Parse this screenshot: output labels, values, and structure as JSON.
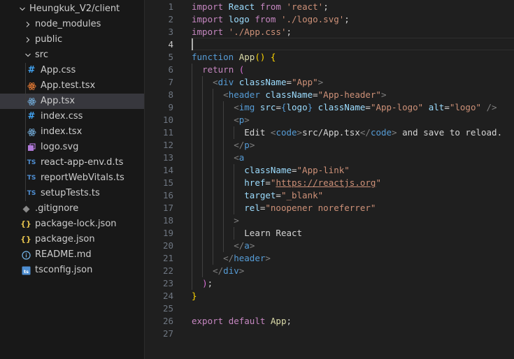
{
  "explorer": {
    "root_label": "Heungkuk_V2/client",
    "items": [
      {
        "label": "node_modules",
        "kind": "folder",
        "icon": "chevron-right-icon"
      },
      {
        "label": "public",
        "kind": "folder",
        "icon": "chevron-right-icon"
      },
      {
        "label": "src",
        "kind": "folder-open",
        "icon": "chevron-down-icon"
      },
      {
        "label": "App.css",
        "kind": "file",
        "icon": "css-file-icon",
        "icon_glyph": "#"
      },
      {
        "label": "App.test.tsx",
        "kind": "file",
        "icon": "react-test-file-icon",
        "icon_glyph": "⚙"
      },
      {
        "label": "App.tsx",
        "kind": "file",
        "icon": "react-file-icon",
        "icon_glyph": "⚛",
        "selected": true
      },
      {
        "label": "index.css",
        "kind": "file",
        "icon": "css-file-icon",
        "icon_glyph": "#"
      },
      {
        "label": "index.tsx",
        "kind": "file",
        "icon": "react-file-icon",
        "icon_glyph": "⚛"
      },
      {
        "label": "logo.svg",
        "kind": "file",
        "icon": "svg-file-icon",
        "icon_glyph": "◩"
      },
      {
        "label": "react-app-env.d.ts",
        "kind": "file",
        "icon": "typescript-file-icon",
        "icon_glyph": "TS"
      },
      {
        "label": "reportWebVitals.ts",
        "kind": "file",
        "icon": "typescript-file-icon",
        "icon_glyph": "TS"
      },
      {
        "label": "setupTests.ts",
        "kind": "file",
        "icon": "typescript-file-icon",
        "icon_glyph": "TS"
      },
      {
        "label": ".gitignore",
        "kind": "file",
        "icon": "gitignore-file-icon",
        "icon_glyph": "◆"
      },
      {
        "label": "package-lock.json",
        "kind": "file",
        "icon": "json-file-icon",
        "icon_glyph": "{}"
      },
      {
        "label": "package.json",
        "kind": "file",
        "icon": "json-file-icon",
        "icon_glyph": "{}"
      },
      {
        "label": "README.md",
        "kind": "file",
        "icon": "info-file-icon",
        "icon_glyph": "ⓘ"
      },
      {
        "label": "tsconfig.json",
        "kind": "file",
        "icon": "tsconfig-file-icon",
        "icon_glyph": "ts"
      }
    ]
  },
  "editor": {
    "active_line": 4,
    "lines": [
      [
        [
          "import",
          "ctl"
        ],
        [
          " ",
          "t"
        ],
        [
          "React",
          "v"
        ],
        [
          " ",
          "t"
        ],
        [
          "from",
          "ctl"
        ],
        [
          " ",
          "t"
        ],
        [
          "'react'",
          "s"
        ],
        [
          ";",
          "t"
        ]
      ],
      [
        [
          "import",
          "ctl"
        ],
        [
          " ",
          "t"
        ],
        [
          "logo",
          "v"
        ],
        [
          " ",
          "t"
        ],
        [
          "from",
          "ctl"
        ],
        [
          " ",
          "t"
        ],
        [
          "'./logo.svg'",
          "s"
        ],
        [
          ";",
          "t"
        ]
      ],
      [
        [
          "import",
          "ctl"
        ],
        [
          " ",
          "t"
        ],
        [
          "'./App.css'",
          "s"
        ],
        [
          ";",
          "t"
        ]
      ],
      [],
      [
        [
          "function",
          "k"
        ],
        [
          " ",
          "t"
        ],
        [
          "App",
          "fn"
        ],
        [
          "()",
          "y"
        ],
        [
          " ",
          "t"
        ],
        [
          "{",
          "y"
        ]
      ],
      [
        [
          "  ",
          "t"
        ],
        [
          "return",
          "ctl"
        ],
        [
          " ",
          "t"
        ],
        [
          "(",
          "pk"
        ]
      ],
      [
        [
          "    ",
          "t"
        ],
        [
          "<",
          "p"
        ],
        [
          "div",
          "tg"
        ],
        [
          " ",
          "t"
        ],
        [
          "className",
          "v"
        ],
        [
          "=",
          "t"
        ],
        [
          "\"App\"",
          "s"
        ],
        [
          ">",
          "p"
        ]
      ],
      [
        [
          "      ",
          "t"
        ],
        [
          "<",
          "p"
        ],
        [
          "header",
          "tg"
        ],
        [
          " ",
          "t"
        ],
        [
          "className",
          "v"
        ],
        [
          "=",
          "t"
        ],
        [
          "\"App-header\"",
          "s"
        ],
        [
          ">",
          "p"
        ]
      ],
      [
        [
          "        ",
          "t"
        ],
        [
          "<",
          "p"
        ],
        [
          "img",
          "tg"
        ],
        [
          " ",
          "t"
        ],
        [
          "src",
          "v"
        ],
        [
          "=",
          "t"
        ],
        [
          "{",
          "k"
        ],
        [
          "logo",
          "v"
        ],
        [
          "}",
          "k"
        ],
        [
          " ",
          "t"
        ],
        [
          "className",
          "v"
        ],
        [
          "=",
          "t"
        ],
        [
          "\"App-logo\"",
          "s"
        ],
        [
          " ",
          "t"
        ],
        [
          "alt",
          "v"
        ],
        [
          "=",
          "t"
        ],
        [
          "\"logo\"",
          "s"
        ],
        [
          " ",
          "t"
        ],
        [
          "/>",
          "p"
        ]
      ],
      [
        [
          "        ",
          "t"
        ],
        [
          "<",
          "p"
        ],
        [
          "p",
          "tg"
        ],
        [
          ">",
          "p"
        ]
      ],
      [
        [
          "          ",
          "t"
        ],
        [
          "Edit ",
          "t"
        ],
        [
          "<",
          "p"
        ],
        [
          "code",
          "tg"
        ],
        [
          ">",
          "p"
        ],
        [
          "src/App.tsx",
          "t"
        ],
        [
          "</",
          "p"
        ],
        [
          "code",
          "tg"
        ],
        [
          ">",
          "p"
        ],
        [
          " and save to reload.",
          "t"
        ]
      ],
      [
        [
          "        ",
          "t"
        ],
        [
          "</",
          "p"
        ],
        [
          "p",
          "tg"
        ],
        [
          ">",
          "p"
        ]
      ],
      [
        [
          "        ",
          "t"
        ],
        [
          "<",
          "p"
        ],
        [
          "a",
          "tg"
        ]
      ],
      [
        [
          "          ",
          "t"
        ],
        [
          "className",
          "v"
        ],
        [
          "=",
          "t"
        ],
        [
          "\"App-link\"",
          "s"
        ]
      ],
      [
        [
          "          ",
          "t"
        ],
        [
          "href",
          "v"
        ],
        [
          "=",
          "t"
        ],
        [
          "\"",
          "s"
        ],
        [
          "https://reactjs.org",
          "u"
        ],
        [
          "\"",
          "s"
        ]
      ],
      [
        [
          "          ",
          "t"
        ],
        [
          "target",
          "v"
        ],
        [
          "=",
          "t"
        ],
        [
          "\"_blank\"",
          "s"
        ]
      ],
      [
        [
          "          ",
          "t"
        ],
        [
          "rel",
          "v"
        ],
        [
          "=",
          "t"
        ],
        [
          "\"noopener noreferrer\"",
          "s"
        ]
      ],
      [
        [
          "        ",
          "t"
        ],
        [
          ">",
          "p"
        ]
      ],
      [
        [
          "          ",
          "t"
        ],
        [
          "Learn React",
          "t"
        ]
      ],
      [
        [
          "        ",
          "t"
        ],
        [
          "</",
          "p"
        ],
        [
          "a",
          "tg"
        ],
        [
          ">",
          "p"
        ]
      ],
      [
        [
          "      ",
          "t"
        ],
        [
          "</",
          "p"
        ],
        [
          "header",
          "tg"
        ],
        [
          ">",
          "p"
        ]
      ],
      [
        [
          "    ",
          "t"
        ],
        [
          "</",
          "p"
        ],
        [
          "div",
          "tg"
        ],
        [
          ">",
          "p"
        ]
      ],
      [
        [
          "  ",
          "t"
        ],
        [
          ")",
          "pk"
        ],
        [
          ";",
          "t"
        ]
      ],
      [
        [
          "}",
          "y"
        ]
      ],
      [],
      [
        [
          "export",
          "ctl"
        ],
        [
          " ",
          "t"
        ],
        [
          "default",
          "ctl"
        ],
        [
          " ",
          "t"
        ],
        [
          "App",
          "fn"
        ],
        [
          ";",
          "t"
        ]
      ],
      []
    ]
  },
  "colors": {
    "sidebar_bg": "#181818",
    "editor_bg": "#1f1f1f",
    "selected_row": "#37373d",
    "css_icon": "#42a5f5",
    "ts_icon": "#4f8fd3",
    "react_icon": "#6ea4cf",
    "test_icon": "#e37933",
    "svg_icon": "#b079d9",
    "json_icon": "#e2c04d",
    "info_icon": "#74b4e8"
  }
}
